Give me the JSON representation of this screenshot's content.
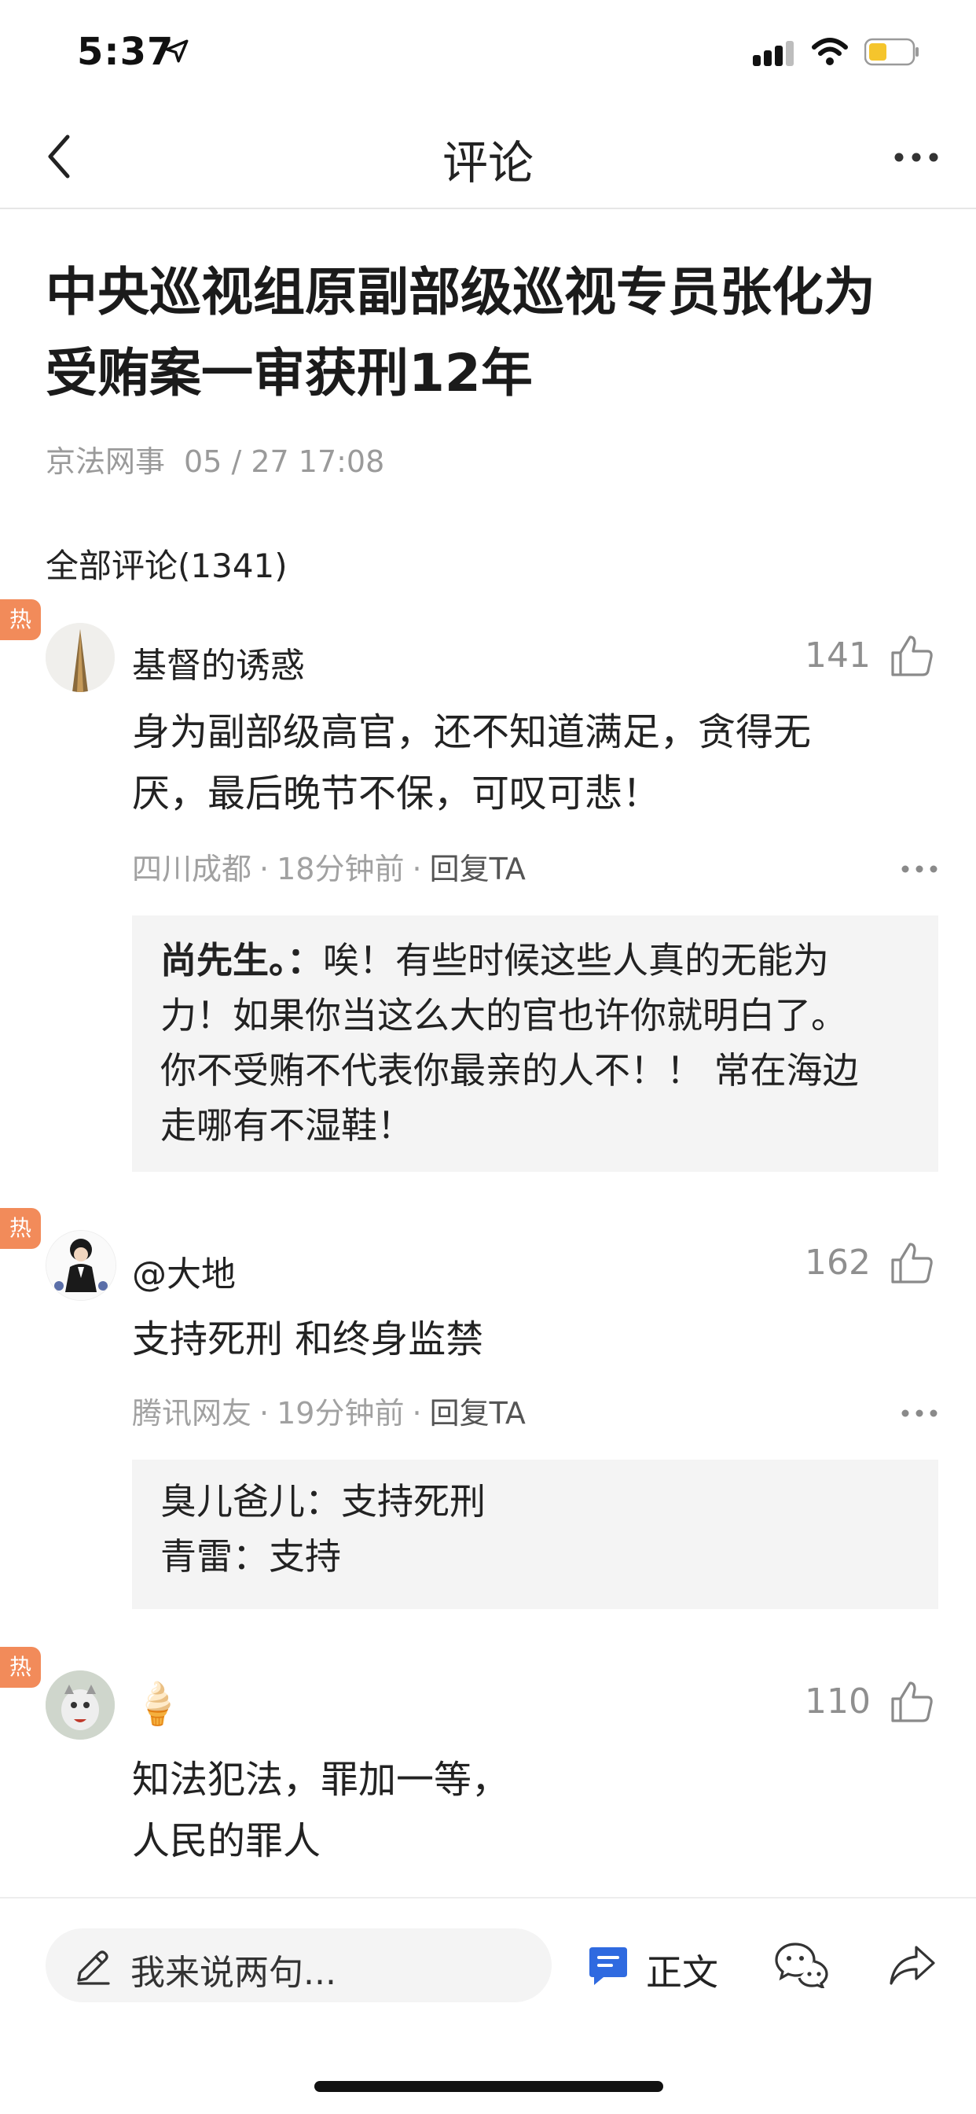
{
  "status_bar": {
    "time": "5:37"
  },
  "nav": {
    "title": "评论"
  },
  "article": {
    "title_line1": "中央巡视组原副部级巡视专员张化为",
    "title_line2": "受贿案一审获刑12年",
    "source": "京法网事",
    "date": "05 / 27 17:08"
  },
  "comments_header": "全部评论(1341)",
  "hot_label": "热",
  "comments": [
    {
      "username": "基督的诱惑",
      "likes": "141",
      "text_line1": "身为副部级高官，还不知道满足，贪得无",
      "text_line2": "厌，最后晚节不保，可叹可悲！",
      "location": "四川成都",
      "time": "18分钟前",
      "reply": "回复TA",
      "replies": [
        {
          "name": "尚先生。",
          "sep": "：",
          "line1": "唉！有些时候这些人真的无能为",
          "line2": "力！如果你当这么大的官也许你就明白了。",
          "line3": "你不受贿不代表你最亲的人不！！ 常在海边",
          "line4": "走哪有不湿鞋！"
        }
      ]
    },
    {
      "username": "@大地",
      "likes": "162",
      "text_line1": "支持死刑 和终身监禁",
      "location": "腾讯网友",
      "time": "19分钟前",
      "reply": "回复TA",
      "replies": [
        {
          "name": "臭儿爸儿",
          "sep": "：",
          "text": "支持死刑"
        },
        {
          "name": "青雷",
          "sep": "：",
          "text": "支持"
        }
      ]
    },
    {
      "username": "🍦",
      "likes": "110",
      "text_line1": "知法犯法，罪加一等，",
      "text_line2": "人民的罪人"
    }
  ],
  "bottom_bar": {
    "placeholder": "我来说两句...",
    "doc_label": "正文"
  },
  "icons": {
    "back": "chevron-left-icon",
    "more": "more-horizontal-icon",
    "thumb": "thumbs-up-icon",
    "pen": "pen-icon",
    "doc": "document-icon",
    "chat": "wechat-icon",
    "share": "share-icon"
  },
  "colors": {
    "hot_tag": "#f28b5a",
    "doc_icon": "#2f6ae0",
    "battery": "#f5c52c"
  }
}
